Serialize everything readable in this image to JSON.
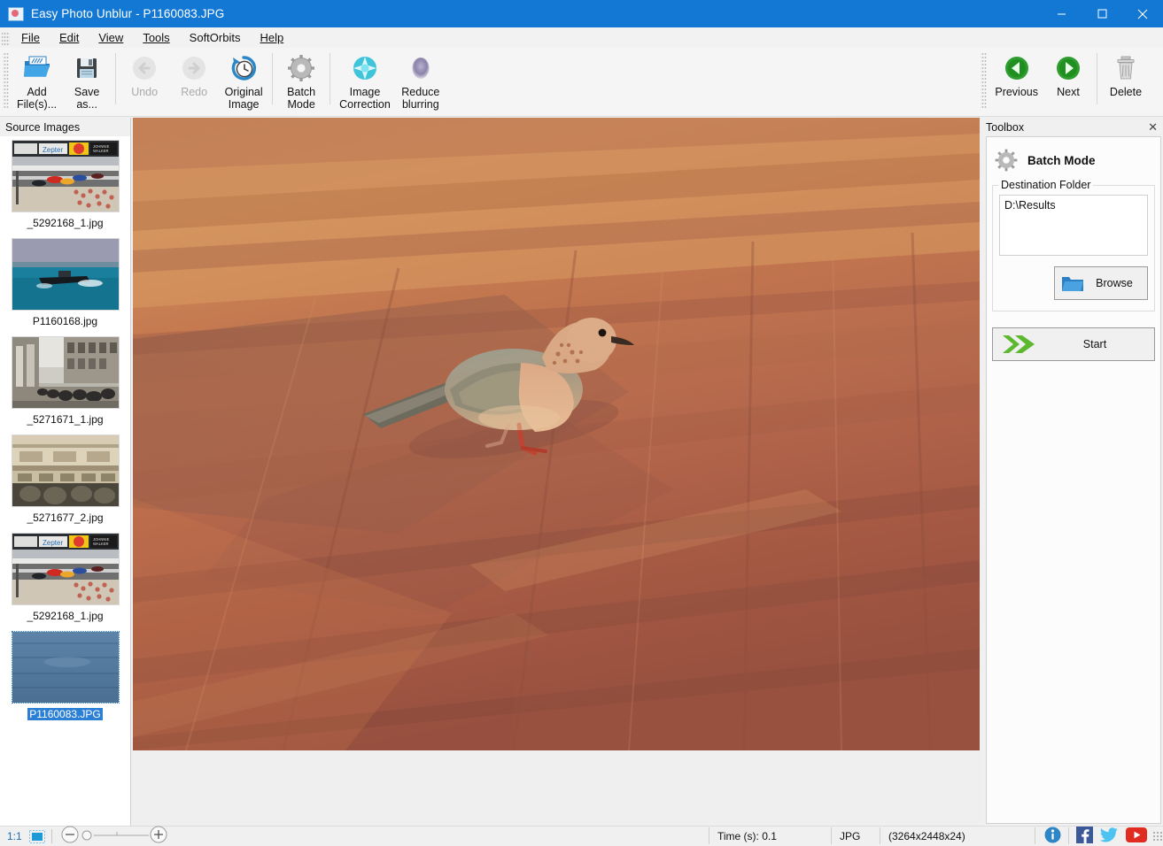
{
  "window": {
    "title": "Easy Photo Unblur - P1160083.JPG",
    "app_icon": "photo-app-icon",
    "accent_color": "#1278d4",
    "controls": [
      {
        "name": "minimize",
        "glyph": "minimize-icon"
      },
      {
        "name": "maximize",
        "glyph": "maximize-icon"
      },
      {
        "name": "close",
        "glyph": "close-icon"
      }
    ]
  },
  "menu": {
    "items": [
      {
        "label": "File",
        "accel": "F"
      },
      {
        "label": "Edit",
        "accel": "E"
      },
      {
        "label": "View",
        "accel": "V"
      },
      {
        "label": "Tools",
        "accel": "T"
      },
      {
        "label": "SoftOrbits",
        "accel": ""
      },
      {
        "label": "Help",
        "accel": "H"
      }
    ]
  },
  "toolbar": {
    "left_items": [
      {
        "id": "add-files",
        "label": "Add\nFile(s)...",
        "icon": "open-folder-icon",
        "disabled": false
      },
      {
        "id": "save-as",
        "label": "Save\nas...",
        "icon": "floppy-disk-icon",
        "disabled": false
      },
      {
        "id": "undo",
        "label": "Undo",
        "icon": "undo-arrow-icon",
        "disabled": true
      },
      {
        "id": "redo",
        "label": "Redo",
        "icon": "redo-arrow-icon",
        "disabled": true
      },
      {
        "id": "original-image",
        "label": "Original\nImage",
        "icon": "clock-history-icon",
        "disabled": false
      },
      {
        "id": "batch-mode",
        "label": "Batch\nMode",
        "icon": "gear-icon",
        "disabled": false
      },
      {
        "id": "image-correction",
        "label": "Image\nCorrection",
        "icon": "starburst-cyan-icon",
        "disabled": false
      },
      {
        "id": "reduce-blurring",
        "label": "Reduce\nblurring",
        "icon": "blur-blob-icon",
        "disabled": false
      }
    ],
    "right_items": [
      {
        "id": "previous",
        "label": "Previous",
        "icon": "green-left-arrow-icon"
      },
      {
        "id": "next",
        "label": "Next",
        "icon": "green-right-arrow-icon"
      },
      {
        "id": "delete",
        "label": "Delete",
        "icon": "trash-can-icon"
      }
    ]
  },
  "source_panel": {
    "header": "Source Images",
    "items": [
      {
        "name": "_5292168_1.jpg",
        "thumb": "formula1-race-thumb",
        "selected": false
      },
      {
        "name": "P1160168.jpg",
        "thumb": "boat-sea-thumb",
        "selected": false
      },
      {
        "name": "_5271671_1.jpg",
        "thumb": "city-street-thumb",
        "selected": false
      },
      {
        "name": "_5271677_2.jpg",
        "thumb": "stone-facade-thumb",
        "selected": false
      },
      {
        "name": "_5292168_1.jpg",
        "thumb": "formula1-race-thumb",
        "selected": false
      },
      {
        "name": "P1160083.JPG",
        "thumb": "pigeon-plaza-thumb",
        "selected": true
      }
    ]
  },
  "canvas": {
    "image_name": "P1160083.JPG",
    "description": "dove walking on orange terracotta paving stones"
  },
  "toolbox": {
    "header": "Toolbox",
    "close_glyph": "✕",
    "panel_title": "Batch Mode",
    "panel_icon": "gear-icon",
    "group_legend": "Destination Folder",
    "destination_value": "D:\\Results",
    "browse_label": "Browse",
    "browse_icon": "open-folder-icon",
    "start_label": "Start",
    "start_icon": "green-double-chevron-icon"
  },
  "statusbar": {
    "zoom_label": "1:1",
    "fit_icon": "fit-to-window-icon",
    "zoom_out_icon": "minus-icon",
    "zoom_in_icon": "plus-icon",
    "time_text": "Time (s): 0.1",
    "format_text": "JPG",
    "dimensions_text": "(3264x2448x24)",
    "social": [
      {
        "id": "info",
        "icon": "info-icon",
        "color": "#1f7fc4"
      },
      {
        "id": "facebook",
        "icon": "facebook-icon",
        "color": "#3b5998"
      },
      {
        "id": "twitter",
        "icon": "twitter-icon",
        "color": "#4cc3f0"
      },
      {
        "id": "youtube",
        "icon": "youtube-icon",
        "color": "#e02b20"
      }
    ]
  }
}
